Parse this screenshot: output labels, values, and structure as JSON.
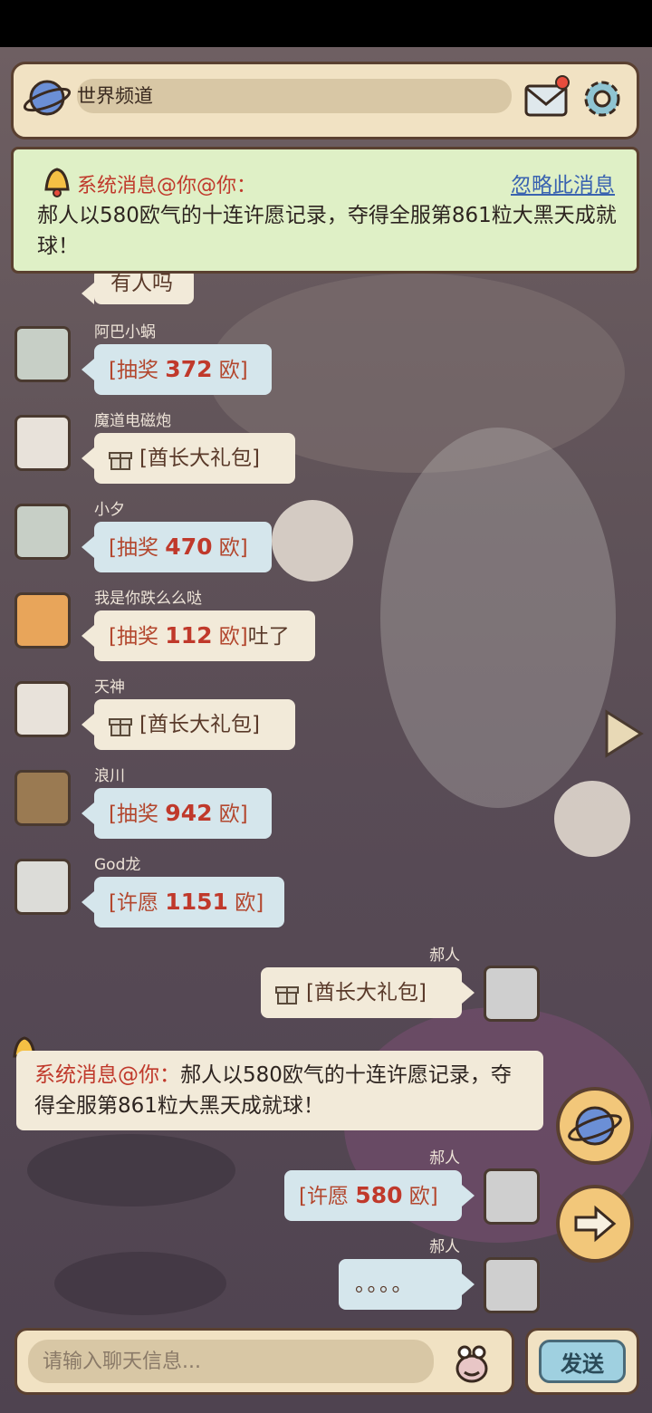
{
  "header": {
    "channel_label": "世界频道"
  },
  "banner": {
    "title": "系统消息@你@你：",
    "ignore_label": "忽略此消息",
    "text": "郝人以580欧气的十连许愿记录，夺得全服第861粒大黑天成就球！"
  },
  "partial_message": {
    "text": "有人吗"
  },
  "messages": [
    {
      "name": "阿巴小蜗",
      "prefix": "[抽奖 ",
      "number": "372",
      "suffix": " 欧]",
      "after": ""
    },
    {
      "name": "魔道电磁炮",
      "text": "[酋长大礼包]"
    },
    {
      "name": "小夕",
      "prefix": "[抽奖 ",
      "number": "470",
      "suffix": " 欧]",
      "after": ""
    },
    {
      "name": "我是你跌么么哒",
      "prefix": "[抽奖 ",
      "number": "112",
      "suffix": " 欧]",
      "after": "吐了"
    },
    {
      "name": "天神",
      "text": "[酋长大礼包]"
    },
    {
      "name": "浪川",
      "prefix": "[抽奖 ",
      "number": "942",
      "suffix": " 欧]",
      "after": ""
    },
    {
      "name": "God龙",
      "prefix": "[许愿 ",
      "number": "1151",
      "suffix": " 欧]",
      "after": ""
    }
  ],
  "own_messages": [
    {
      "name": "郝人",
      "text": "[酋长大礼包]"
    },
    {
      "name": "郝人",
      "prefix": "[许愿 ",
      "number": "580",
      "suffix": " 欧]"
    },
    {
      "name": "郝人",
      "text": "。。。。"
    }
  ],
  "system_message": {
    "title": "系统消息@你：",
    "text": "郝人以580欧气的十连许愿记录，夺得全服第861粒大黑天成就球！"
  },
  "input": {
    "placeholder": "请输入聊天信息..."
  },
  "send_label": "发送",
  "colors": {
    "accent_red": "#c0392b",
    "link_blue": "#3a63b0",
    "banner_green": "#dff0c6",
    "bubble_blue": "#d5e6ec",
    "bubble_white": "#f2ead9"
  }
}
